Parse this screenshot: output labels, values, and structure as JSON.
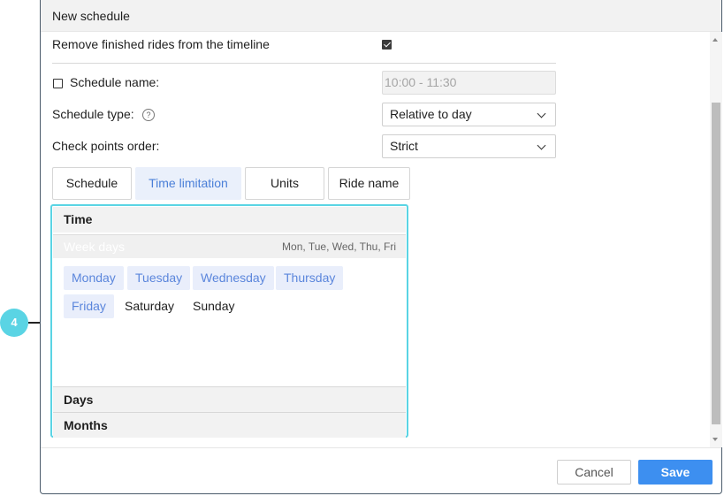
{
  "dialog": {
    "title": "New schedule"
  },
  "form": {
    "remove_finished_label": "Remove finished rides from the timeline",
    "remove_finished_checked": true,
    "schedule_name_label": "Schedule name:",
    "schedule_name_checked": false,
    "schedule_name_value": "10:00 - 11:30",
    "schedule_type_label": "Schedule type:",
    "schedule_type_value": "Relative to day",
    "check_points_label": "Check points order:",
    "check_points_value": "Strict"
  },
  "tabs": [
    {
      "label": "Schedule",
      "active": false
    },
    {
      "label": "Time limitation",
      "active": true
    },
    {
      "label": "Units",
      "active": false
    },
    {
      "label": "Ride name",
      "active": false
    }
  ],
  "panel": {
    "time_heading": "Time",
    "week_days_label": "Week days",
    "week_days_value": "Mon, Tue, Wed, Thu, Fri",
    "days": [
      {
        "label": "Monday",
        "selected": true
      },
      {
        "label": "Tuesday",
        "selected": true
      },
      {
        "label": "Wednesday",
        "selected": true
      },
      {
        "label": "Thursday",
        "selected": true
      },
      {
        "label": "Friday",
        "selected": true
      },
      {
        "label": "Saturday",
        "selected": false
      },
      {
        "label": "Sunday",
        "selected": false
      }
    ],
    "days_heading": "Days",
    "months_heading": "Months"
  },
  "footer": {
    "cancel_label": "Cancel",
    "save_label": "Save"
  },
  "callout": {
    "number": "4"
  },
  "colors": {
    "accent": "#3d8ff0",
    "highlight": "#5ad4e4",
    "chip_bg": "#e9eefb",
    "chip_text": "#5b86dc"
  }
}
